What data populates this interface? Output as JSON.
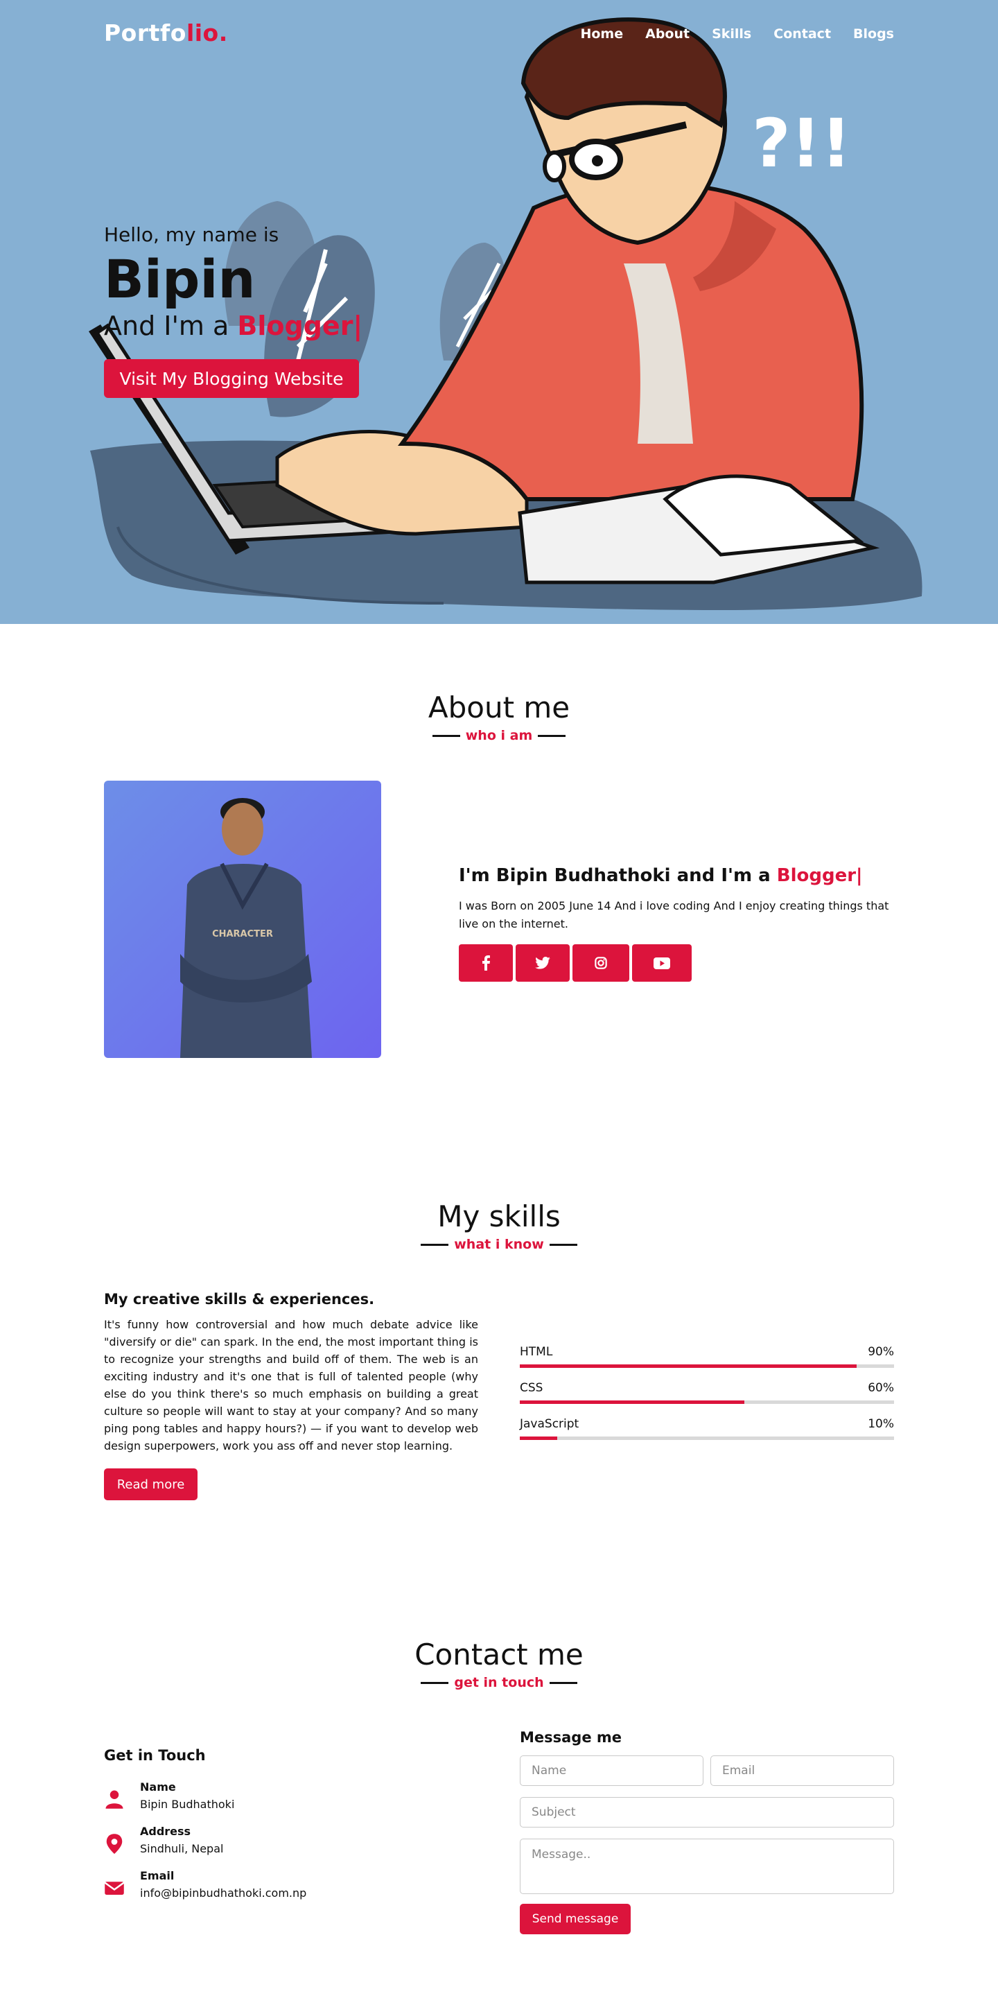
{
  "colors": {
    "accent": "#dc143c",
    "hero_bg": "#86b0d3"
  },
  "nav": {
    "logo_main": "Portfo",
    "logo_accent": "lio.",
    "items": [
      "Home",
      "About",
      "Skills",
      "Contact",
      "Blogs"
    ]
  },
  "hero": {
    "greeting": "Hello, my name is",
    "name": "Bipin",
    "role_prefix": "And I'm a",
    "role_typed": "Blogger|",
    "cta": "Visit My Blogging Website",
    "exclaim": "?!!"
  },
  "about": {
    "title": "About me",
    "subtitle": "who i am",
    "heading_prefix": "I'm Bipin Budhathoki and I'm a",
    "heading_typed": "Blogger|",
    "text": "I was Born on 2005 June 14 And i love coding And I enjoy creating things that live on the internet.",
    "photo_shirt_text": "CHARACTER",
    "social_icons": [
      "facebook-icon",
      "twitter-icon",
      "instagram-icon",
      "youtube-icon"
    ]
  },
  "skills": {
    "title": "My skills",
    "subtitle": "what i know",
    "heading": "My creative skills & experiences.",
    "text": "It's funny how controversial and how much debate advice like \"diversify or die\" can spark. In the end, the most important thing is to recognize your strengths and build off of them. The web is an exciting industry and it's one that is full of talented people (why else do you think there's so much emphasis on building a great culture so people will want to stay at your company? And so many ping pong tables and happy hours?) — if you want to develop web design superpowers, work you ass off and never stop learning.",
    "read_more": "Read more",
    "bars": [
      {
        "name": "HTML",
        "percent_label": "90%",
        "level": 0.9
      },
      {
        "name": "CSS",
        "percent_label": "60%",
        "level": 0.6
      },
      {
        "name": "JavaScript",
        "percent_label": "10%",
        "level": 0.1
      }
    ]
  },
  "contact": {
    "title": "Contact me",
    "subtitle": "get in touch",
    "get_in_touch": "Get in Touch",
    "info": [
      {
        "label": "Name",
        "value": "Bipin Budhathoki",
        "icon": "user-icon"
      },
      {
        "label": "Address",
        "value": "Sindhuli, Nepal",
        "icon": "map-marker-icon"
      },
      {
        "label": "Email",
        "value": "info@bipinbudhathoki.com.np",
        "icon": "envelope-icon"
      }
    ],
    "form": {
      "heading": "Message me",
      "name_placeholder": "Name",
      "email_placeholder": "Email",
      "subject_placeholder": "Subject",
      "message_placeholder": "Message..",
      "send": "Send message"
    }
  }
}
